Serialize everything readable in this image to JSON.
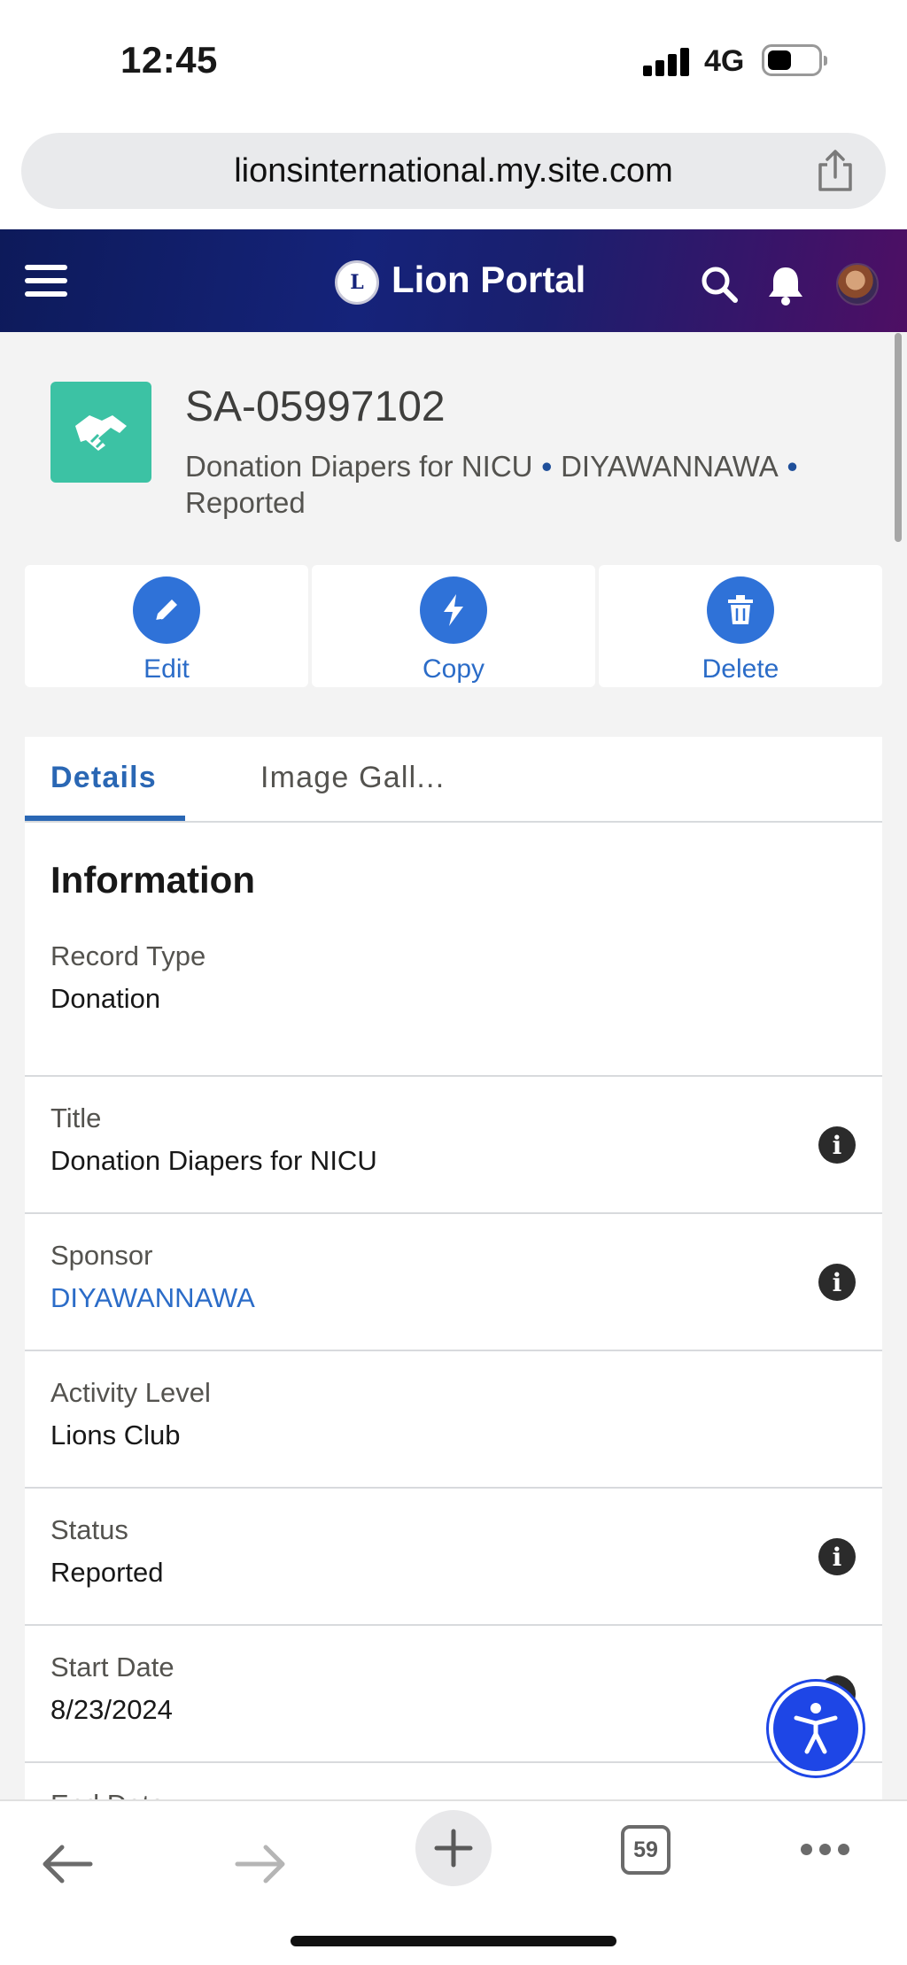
{
  "status_bar": {
    "time": "12:45",
    "network": "4G"
  },
  "browser": {
    "url": "lionsinternational.my.site.com",
    "open_tabs": "59"
  },
  "header": {
    "title": "Lion Portal",
    "logo_letter": "L"
  },
  "record": {
    "id": "SA-05997102",
    "title": "Donation Diapers for NICU",
    "sponsor": "DIYAWANNAWA",
    "status": "Reported",
    "separator": "•"
  },
  "actions": {
    "edit": "Edit",
    "copy": "Copy",
    "delete": "Delete"
  },
  "tabs": {
    "details": "Details",
    "gallery": "Image Gall..."
  },
  "section": {
    "title": "Information"
  },
  "fields": [
    {
      "label": "Record Type",
      "value": "Donation"
    },
    {
      "label": "Title",
      "value": "Donation Diapers for NICU"
    },
    {
      "label": "Sponsor",
      "value": "DIYAWANNAWA"
    },
    {
      "label": "Activity Level",
      "value": "Lions Club"
    },
    {
      "label": "Status",
      "value": "Reported"
    },
    {
      "label": "Start Date",
      "value": "8/23/2024"
    },
    {
      "label": "End Date",
      "value": ""
    }
  ],
  "info_glyph": "i",
  "colors": {
    "brand_teal": "#3cc2a4",
    "action_blue": "#2f72d8",
    "link_blue": "#2b6cc8",
    "header_navy": "#15237a"
  }
}
